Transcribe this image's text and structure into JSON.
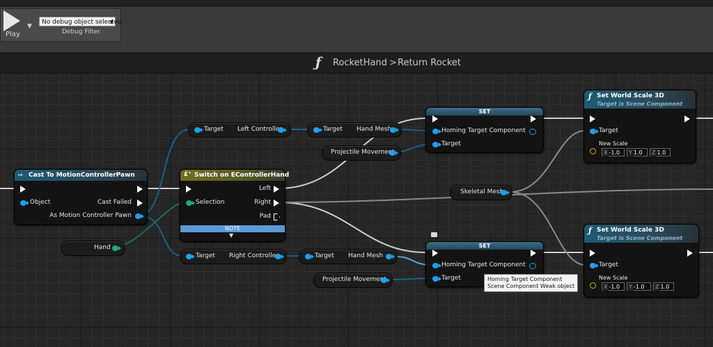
{
  "toolbar": {
    "play_label": "Play",
    "debug_select_value": "No debug object selected",
    "debug_filter_label": "Debug Filter"
  },
  "breadcrumb": {
    "icon": "function-icon",
    "parent": "RocketHand",
    "separator": ">",
    "current": "Return Rocket"
  },
  "nodes": {
    "cast": {
      "title": "Cast To MotionControllerPawn",
      "object_pin": "Object",
      "cast_failed_pin": "Cast Failed",
      "as_pin": "As Motion Controller Pawn"
    },
    "switch": {
      "title": "Switch on EControllerHand",
      "selection_pin": "Selection",
      "left_pin": "Left",
      "right_pin": "Right",
      "pad_pin": "Pad",
      "note_label": "NOTE"
    },
    "hand_var": {
      "label": "Hand"
    },
    "left_controller": {
      "target_pin": "Target",
      "output_pin": "Left Controller"
    },
    "right_controller": {
      "target_pin": "Target",
      "output_pin": "Right Controller"
    },
    "hand_mesh_top": {
      "target_pin": "Target",
      "output_pin": "Hand Mesh"
    },
    "hand_mesh_bottom": {
      "target_pin": "Target",
      "output_pin": "Hand Mesh"
    },
    "projectile_top": {
      "label": "Projectile Movement"
    },
    "projectile_bottom": {
      "label": "Projectile Movement"
    },
    "skeletal_mesh": {
      "label": "Skeletal Mesh"
    },
    "set_top": {
      "title": "SET",
      "homing_pin": "Homing Target Component",
      "target_pin": "Target"
    },
    "set_bottom": {
      "title": "SET",
      "homing_pin": "Homing Target Component",
      "target_pin": "Target"
    },
    "scale_top": {
      "title": "Set World Scale 3D",
      "subtitle": "Target is Scene Component",
      "target_pin": "Target",
      "new_scale_label": "New Scale",
      "axis_x": "X",
      "value_x": "-1.0",
      "axis_y": "Y",
      "value_y": "1.0",
      "axis_z": "Z",
      "value_z": "1.0"
    },
    "scale_bottom": {
      "title": "Set World Scale 3D",
      "subtitle": "Target is Scene Component",
      "target_pin": "Target",
      "new_scale_label": "New Scale",
      "axis_x": "X",
      "value_x": "-1.0",
      "axis_y": "Y",
      "value_y": "-1.0",
      "axis_z": "Z",
      "value_z": "1.0"
    }
  },
  "tooltip": {
    "line1": "Homing Target Component",
    "line2": "Scene Component Weak object"
  },
  "colors": {
    "object_pin": "#1ea0ea",
    "enum_pin": "#27a58a",
    "struct_pin": "#e0b000",
    "note_bar": "#5a9ad6"
  }
}
